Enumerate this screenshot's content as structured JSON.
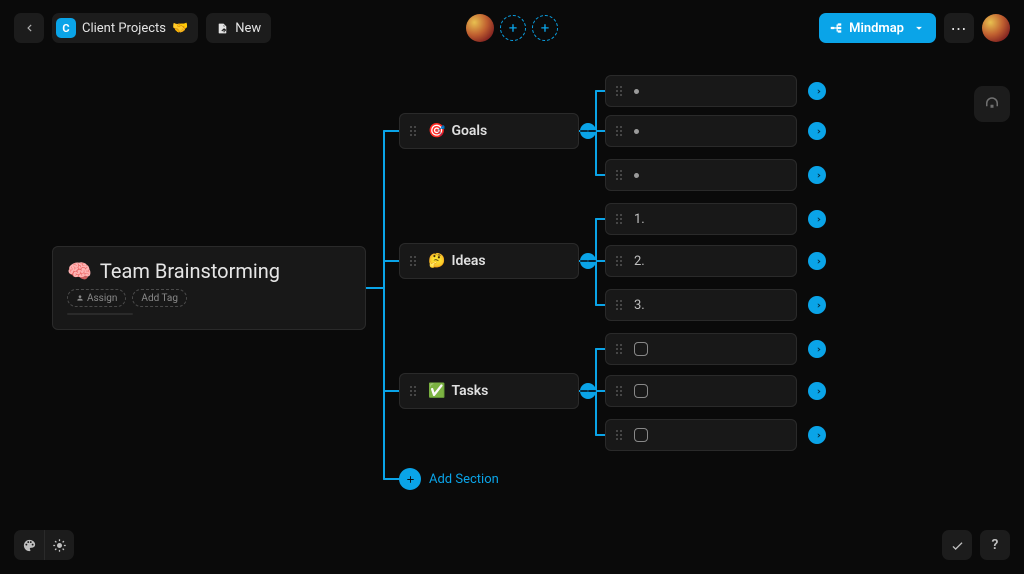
{
  "header": {
    "workspace_initial": "C",
    "breadcrumb": "Client Projects",
    "breadcrumb_emoji": "🤝",
    "new_label": "New",
    "view_label": "Mindmap"
  },
  "root": {
    "emoji": "🧠",
    "title": "Team Brainstorming",
    "assign_chip": "Assign",
    "add_tag_chip": "Add Tag"
  },
  "sections": [
    {
      "emoji": "🎯",
      "label": "Goals"
    },
    {
      "emoji": "🤔",
      "label": "Ideas"
    },
    {
      "emoji": "✅",
      "label": "Tasks"
    }
  ],
  "items": {
    "goals": [
      "",
      "",
      ""
    ],
    "ideas": [
      "1.",
      "2.",
      "3."
    ],
    "tasks": [
      "",
      "",
      ""
    ]
  },
  "add_section_label": "Add Section"
}
